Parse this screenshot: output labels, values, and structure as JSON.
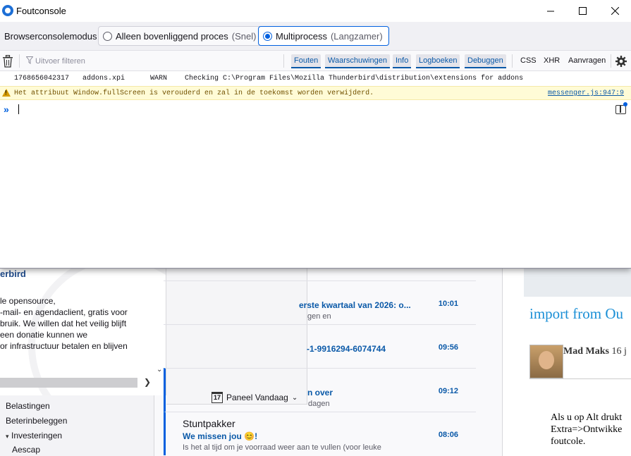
{
  "console": {
    "title": "Foutconsole",
    "mode_label": "Browserconsolemodus",
    "mode_options": [
      {
        "label": "Alleen bovenliggend proces",
        "hint": "(Snel)",
        "selected": false
      },
      {
        "label": "Multiprocess",
        "hint": "(Langzamer)",
        "selected": true
      }
    ],
    "filter_placeholder": "Uitvoer filteren",
    "levels": [
      "Fouten",
      "Waarschuwingen",
      "Info",
      "Logboeken",
      "Debuggen"
    ],
    "extra_filters": [
      "CSS",
      "XHR",
      "Aanvragen"
    ],
    "log": {
      "timestamp": "1768656042317",
      "source": "addons.xpi",
      "level": "WARN",
      "message": "Checking C:\\Program Files\\Mozilla Thunderbird\\distribution\\extensions for addons"
    },
    "warning": {
      "message": "Het attribuut Window.fullScreen is verouderd en zal in de toekomst worden verwijderd.",
      "source": "messenger.js:947:9"
    },
    "prompt_symbol": "»"
  },
  "welcome": {
    "heading": "erbird",
    "text": "le opensource,\n-mail- en agendaclient, gratis voor\nbruik. We willen dat het veilig blijft\neen donatie kunnen we\nor infrastructuur betalen en blijven"
  },
  "today_pane": {
    "label": "Paneel Vandaag",
    "calendar_day": "17"
  },
  "folders": [
    {
      "label": "Belastingen",
      "sub": false,
      "twisty": ""
    },
    {
      "label": "Beterinbeleggen",
      "sub": false,
      "twisty": ""
    },
    {
      "label": "Investeringen",
      "sub": false,
      "twisty": "▾"
    },
    {
      "label": "Aescap",
      "sub": true,
      "twisty": ""
    }
  ],
  "messages": [
    {
      "sender": "",
      "subject": "erste kwartaal van 2026: o...",
      "preview": "gen en",
      "time": "10:01",
      "selected": false
    },
    {
      "sender": "",
      "subject": "-1-9916294-6074744",
      "preview": "",
      "time": "09:56",
      "selected": false
    },
    {
      "sender": "",
      "subject": "n over",
      "preview": "dagen",
      "time": "09:12",
      "selected": true
    },
    {
      "sender": "Stuntpakker",
      "subject": "We missen jou 😊!",
      "preview": "Is het al tijd om je voorraad weer aan te vullen (voor leuke",
      "time": "08:06",
      "selected": true
    }
  ],
  "reader": {
    "heading": "import from Ou",
    "author": "Mad Maks",
    "date": "16 j",
    "body": "Als u op Alt drukt\nExtra=>Ontwikke\nfoutcole."
  }
}
